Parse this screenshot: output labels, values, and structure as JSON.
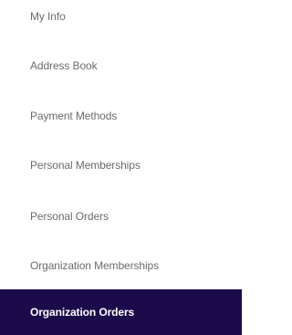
{
  "account_nav": {
    "active_background": "#1b0b4a",
    "items": [
      {
        "label": "My Info"
      },
      {
        "label": "Address Book"
      },
      {
        "label": "Payment Methods"
      },
      {
        "label": "Personal Memberships"
      },
      {
        "label": "Personal Orders"
      },
      {
        "label": "Organization Memberships"
      },
      {
        "label": "Organization Orders",
        "active": true
      }
    ]
  }
}
